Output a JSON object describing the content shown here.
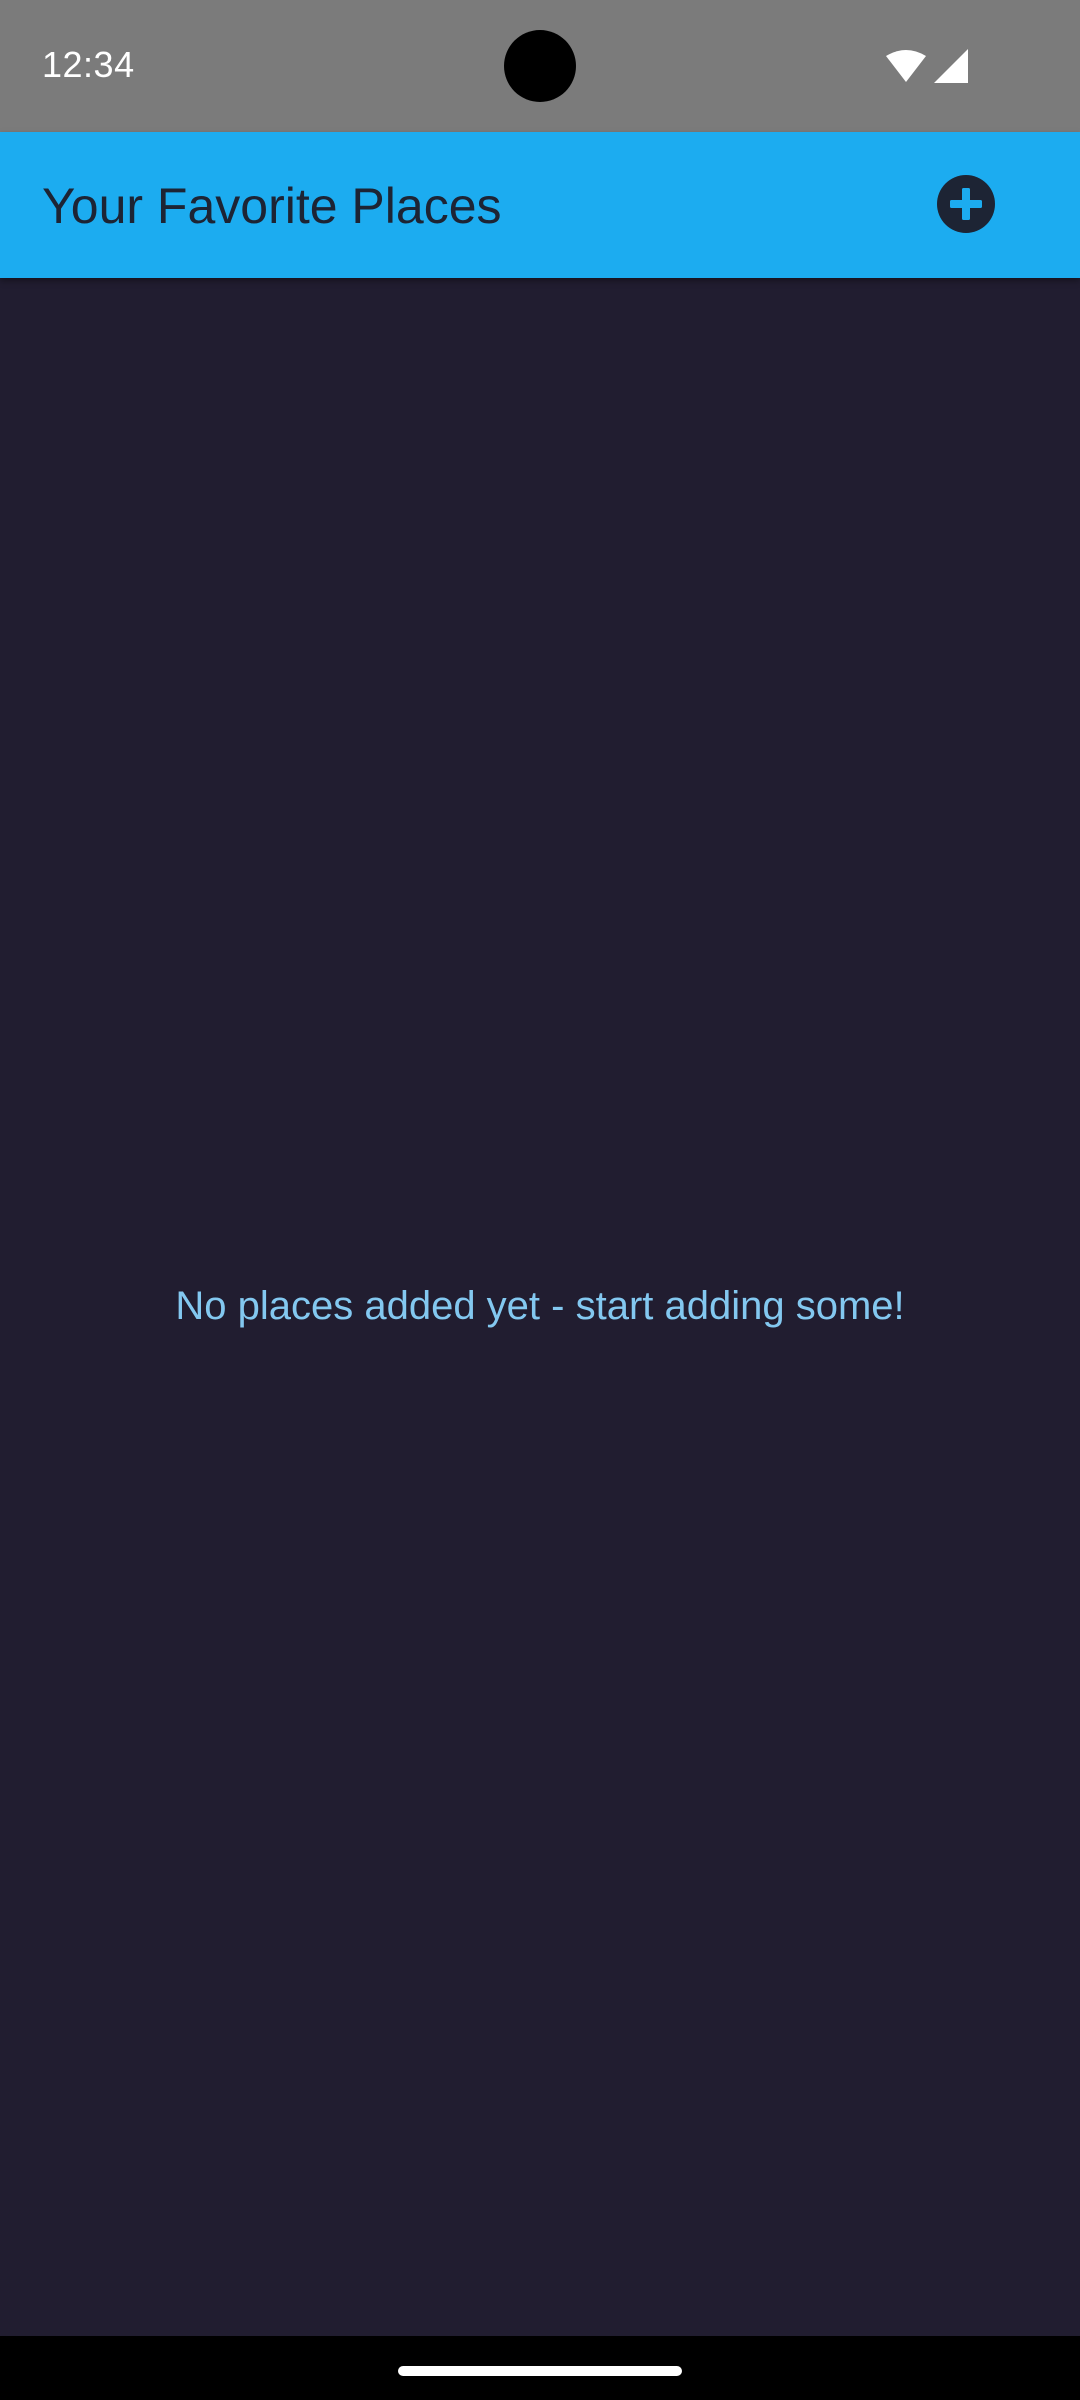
{
  "status_bar": {
    "time": "12:34",
    "icons": [
      "wifi-icon",
      "cellular-signal-icon"
    ]
  },
  "app_bar": {
    "title": "Your Favorite Places",
    "action_icon": "add-circle-icon",
    "background_color": "#1cacf0"
  },
  "main": {
    "empty_message": "No places added yet - start adding some!",
    "background_color": "#211d30",
    "message_color": "#83c8f0"
  },
  "nav_bar": {
    "handle_icon": "gesture-handle"
  }
}
